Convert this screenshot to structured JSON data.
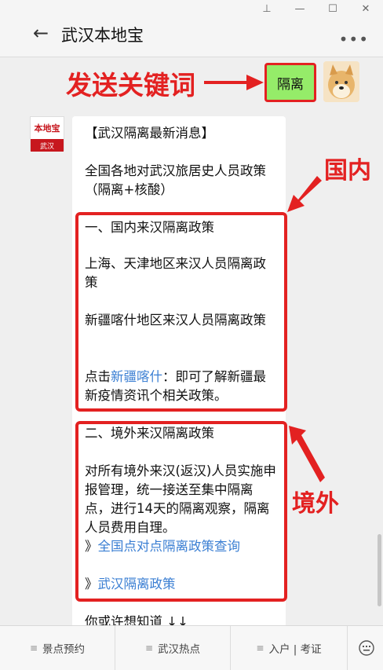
{
  "window": {
    "pin_icon": "pin-icon",
    "min_icon": "minimize-icon",
    "max_icon": "maximize-icon",
    "close_icon": "close-icon"
  },
  "header": {
    "title": "武汉本地宝"
  },
  "annotations": {
    "keyword_label": "发送关键词",
    "domestic_label": "国内",
    "abroad_label": "境外",
    "color": "#e32121"
  },
  "sent_message": {
    "text": "隔离"
  },
  "bot_avatar": {
    "logo_text": "本地宝",
    "city": "武汉"
  },
  "reply": {
    "headline": "【武汉隔离最新消息】",
    "intro": "全国各地对武汉旅居史人员政策（隔离+核酸）",
    "domestic_title": "一、国内来汉隔离政策",
    "link_shanghai": "上海、天津地区来汉人员隔离政策",
    "link_xinjiang": "新疆喀什地区来汉人员隔离政策",
    "click_prefix": "点击",
    "click_link": "新疆喀什",
    "click_suffix": "：即可了解新疆最新疫情资讯个相关政策。",
    "abroad_title": "二、境外来汉隔离政策",
    "abroad_body": "对所有境外来汉(返汉)人员实施申报管理，统一接送至集中隔离点，进行14天的隔离观察，隔离人员费用自理。",
    "link_national_prefix": "》",
    "link_national": "全国点对点隔离政策查询",
    "link_wuhan_prefix": "》",
    "link_wuhan": "武汉隔离政策",
    "more_text": "你或许想知道 ↓↓"
  },
  "menu": [
    {
      "label": "景点预约"
    },
    {
      "label": "武汉热点"
    },
    {
      "label": "入户 | 考证"
    }
  ]
}
